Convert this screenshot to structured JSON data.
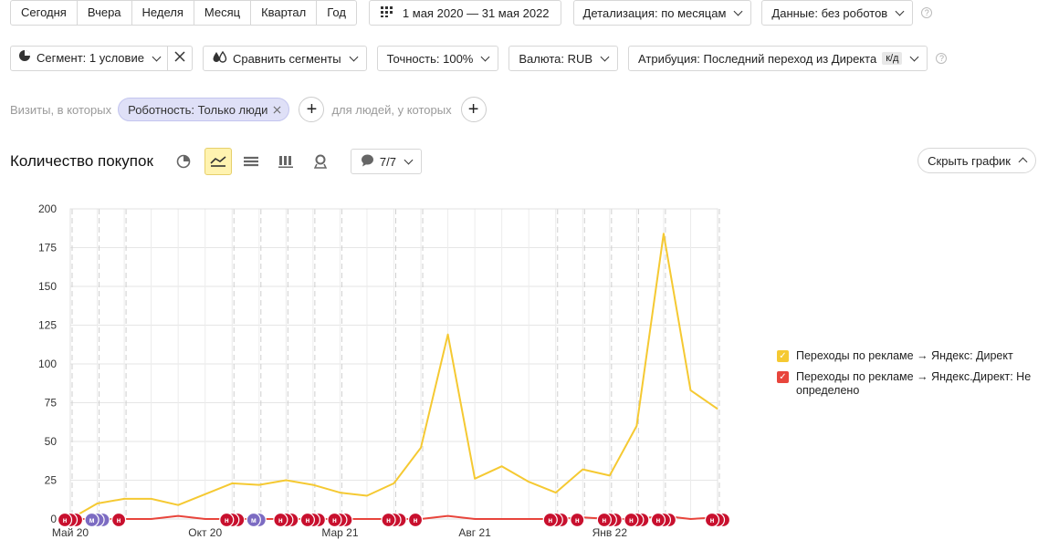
{
  "periods": [
    "Сегодня",
    "Вчера",
    "Неделя",
    "Месяц",
    "Квартал",
    "Год"
  ],
  "date_range": "1 мая 2020 — 31 мая 2022",
  "detail": "Детализация: по месяцам",
  "robots": "Данные: без роботов",
  "segment": "Сегмент: 1 условие",
  "compare": "Сравнить сегменты",
  "accuracy": "Точность: 100%",
  "currency": "Валюта: RUB",
  "attribution": "Атрибуция: Последний переход из Директа",
  "attribution_badge": "к/д",
  "filter_prefix": "Визиты, в которых",
  "filter_chip": "Роботность: Только люди",
  "filter_middle": "для людей, у которых",
  "chart_title": "Количество покупок",
  "series_toggle": "7/7",
  "hide_chart": "Скрыть график",
  "colors": {
    "yellow": "#f5c932",
    "red": "#e8453c",
    "marker_red": "#c8102e",
    "marker_purple": "#7c6bc2"
  },
  "icons": [
    "pie-chart-icon",
    "line-chart-icon",
    "stacked-area-icon",
    "bar-chart-icon",
    "map-pin-icon",
    "comment-icon"
  ],
  "chart_data": {
    "type": "line",
    "x": [
      "2020-05",
      "2020-06",
      "2020-07",
      "2020-08",
      "2020-09",
      "2020-10",
      "2020-11",
      "2020-12",
      "2021-01",
      "2021-02",
      "2021-03",
      "2021-04",
      "2021-05",
      "2021-06",
      "2021-07",
      "2021-08",
      "2021-09",
      "2021-10",
      "2021-11",
      "2021-12",
      "2022-01",
      "2022-02",
      "2022-03",
      "2022-04",
      "2022-05"
    ],
    "x_tick_labels": [
      {
        "x": "2020-05",
        "label": "Май 20"
      },
      {
        "x": "2020-10",
        "label": "Окт 20"
      },
      {
        "x": "2021-03",
        "label": "Мар 21"
      },
      {
        "x": "2021-08",
        "label": "Авг 21"
      },
      {
        "x": "2022-01",
        "label": "Янв 22"
      }
    ],
    "ylim": [
      0,
      200
    ],
    "yticks": [
      0,
      25,
      50,
      75,
      100,
      125,
      150,
      175,
      200
    ],
    "grid": true,
    "legend": "right",
    "series": [
      {
        "name": "Переходы по рекламе → Яндекс: Директ",
        "color": "#f5c932",
        "values": [
          0,
          10,
          13,
          13,
          9,
          16,
          23,
          22,
          25,
          22,
          17,
          15,
          23,
          46,
          119,
          26,
          34,
          24,
          17,
          32,
          28,
          60,
          184,
          83,
          71
        ]
      },
      {
        "name": "Переходы по рекламе → Яндекс.Директ: Не определено",
        "color": "#e8453c",
        "values": [
          0,
          0,
          0,
          0,
          2,
          0,
          0,
          0,
          0,
          0,
          0,
          0,
          0,
          0,
          2,
          0,
          0,
          0,
          0,
          1,
          0,
          0,
          2,
          0,
          1
        ]
      }
    ],
    "event_markers": [
      {
        "x": "2020-05",
        "kind": "н",
        "count": 3
      },
      {
        "x": "2020-06",
        "kind": "м",
        "count": 3
      },
      {
        "x": "2020-07",
        "kind": "н",
        "count": 1
      },
      {
        "x": "2020-11",
        "kind": "н",
        "count": 3
      },
      {
        "x": "2020-12",
        "kind": "м",
        "count": 2
      },
      {
        "x": "2021-01",
        "kind": "н",
        "count": 3
      },
      {
        "x": "2021-02",
        "kind": "н",
        "count": 3
      },
      {
        "x": "2021-03",
        "kind": "н",
        "count": 3
      },
      {
        "x": "2021-05",
        "kind": "н",
        "count": 3
      },
      {
        "x": "2021-06",
        "kind": "н",
        "count": 1
      },
      {
        "x": "2021-11",
        "kind": "н",
        "count": 3
      },
      {
        "x": "2021-12",
        "kind": "н",
        "count": 1
      },
      {
        "x": "2022-01",
        "kind": "н",
        "count": 3
      },
      {
        "x": "2022-02",
        "kind": "н",
        "count": 3
      },
      {
        "x": "2022-03",
        "kind": "н",
        "count": 3
      },
      {
        "x": "2022-05",
        "kind": "н",
        "count": 3
      }
    ]
  }
}
